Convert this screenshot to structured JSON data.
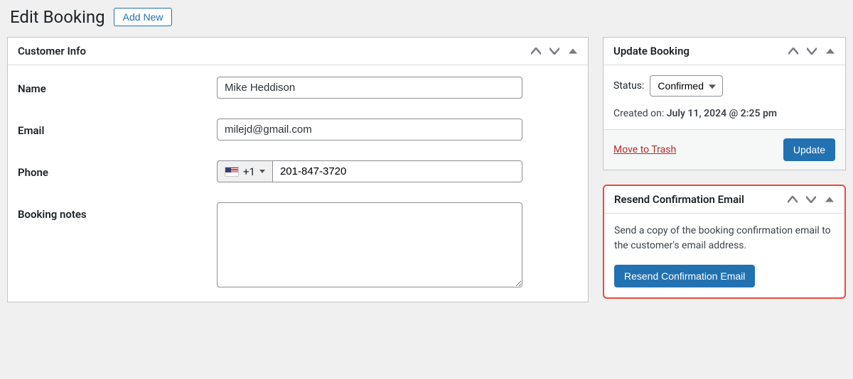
{
  "header": {
    "title": "Edit Booking",
    "add_new": "Add New"
  },
  "customer_panel": {
    "title": "Customer Info",
    "fields": {
      "name_label": "Name",
      "name_value": "Mike Heddison",
      "email_label": "Email",
      "email_value": "milejd@gmail.com",
      "phone_label": "Phone",
      "phone_prefix": "+1",
      "phone_value": "201-847-3720",
      "notes_label": "Booking notes",
      "notes_value": ""
    }
  },
  "update_panel": {
    "title": "Update Booking",
    "status_label": "Status:",
    "status_value": "Confirmed",
    "created_label": "Created on: ",
    "created_value": "July 11, 2024 @ 2:25 pm",
    "trash_label": "Move to Trash",
    "update_button": "Update"
  },
  "resend_panel": {
    "title": "Resend Confirmation Email",
    "description": "Send a copy of the booking confirmation email to the customer's email address.",
    "button": "Resend Confirmation Email"
  }
}
